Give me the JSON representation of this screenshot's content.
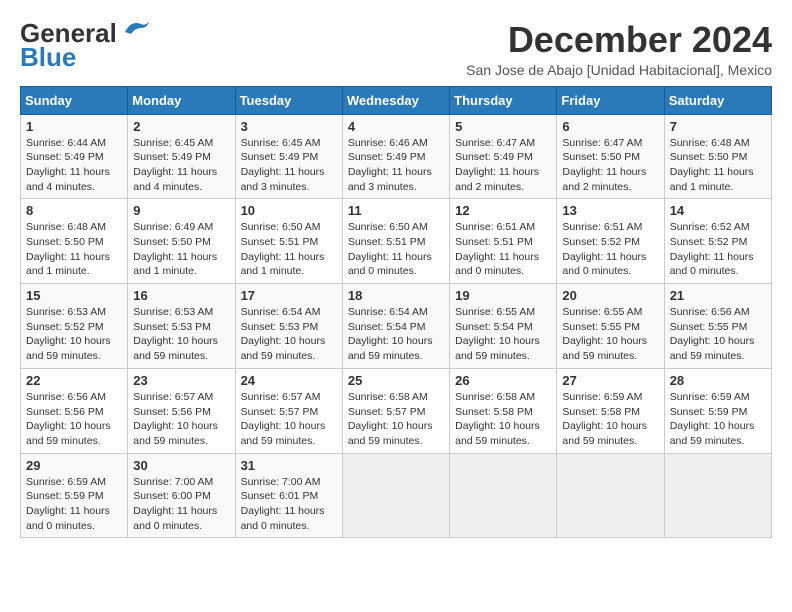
{
  "header": {
    "logo_text1": "General",
    "logo_text2": "Blue",
    "month_title": "December 2024",
    "location": "San Jose de Abajo [Unidad Habitacional], Mexico"
  },
  "weekdays": [
    "Sunday",
    "Monday",
    "Tuesday",
    "Wednesday",
    "Thursday",
    "Friday",
    "Saturday"
  ],
  "weeks": [
    [
      {
        "day": "1",
        "sunrise": "6:44 AM",
        "sunset": "5:49 PM",
        "daylight": "11 hours and 4 minutes."
      },
      {
        "day": "2",
        "sunrise": "6:45 AM",
        "sunset": "5:49 PM",
        "daylight": "11 hours and 4 minutes."
      },
      {
        "day": "3",
        "sunrise": "6:45 AM",
        "sunset": "5:49 PM",
        "daylight": "11 hours and 3 minutes."
      },
      {
        "day": "4",
        "sunrise": "6:46 AM",
        "sunset": "5:49 PM",
        "daylight": "11 hours and 3 minutes."
      },
      {
        "day": "5",
        "sunrise": "6:47 AM",
        "sunset": "5:49 PM",
        "daylight": "11 hours and 2 minutes."
      },
      {
        "day": "6",
        "sunrise": "6:47 AM",
        "sunset": "5:50 PM",
        "daylight": "11 hours and 2 minutes."
      },
      {
        "day": "7",
        "sunrise": "6:48 AM",
        "sunset": "5:50 PM",
        "daylight": "11 hours and 1 minute."
      }
    ],
    [
      {
        "day": "8",
        "sunrise": "6:48 AM",
        "sunset": "5:50 PM",
        "daylight": "11 hours and 1 minute."
      },
      {
        "day": "9",
        "sunrise": "6:49 AM",
        "sunset": "5:50 PM",
        "daylight": "11 hours and 1 minute."
      },
      {
        "day": "10",
        "sunrise": "6:50 AM",
        "sunset": "5:51 PM",
        "daylight": "11 hours and 1 minute."
      },
      {
        "day": "11",
        "sunrise": "6:50 AM",
        "sunset": "5:51 PM",
        "daylight": "11 hours and 0 minutes."
      },
      {
        "day": "12",
        "sunrise": "6:51 AM",
        "sunset": "5:51 PM",
        "daylight": "11 hours and 0 minutes."
      },
      {
        "day": "13",
        "sunrise": "6:51 AM",
        "sunset": "5:52 PM",
        "daylight": "11 hours and 0 minutes."
      },
      {
        "day": "14",
        "sunrise": "6:52 AM",
        "sunset": "5:52 PM",
        "daylight": "11 hours and 0 minutes."
      }
    ],
    [
      {
        "day": "15",
        "sunrise": "6:53 AM",
        "sunset": "5:52 PM",
        "daylight": "10 hours and 59 minutes."
      },
      {
        "day": "16",
        "sunrise": "6:53 AM",
        "sunset": "5:53 PM",
        "daylight": "10 hours and 59 minutes."
      },
      {
        "day": "17",
        "sunrise": "6:54 AM",
        "sunset": "5:53 PM",
        "daylight": "10 hours and 59 minutes."
      },
      {
        "day": "18",
        "sunrise": "6:54 AM",
        "sunset": "5:54 PM",
        "daylight": "10 hours and 59 minutes."
      },
      {
        "day": "19",
        "sunrise": "6:55 AM",
        "sunset": "5:54 PM",
        "daylight": "10 hours and 59 minutes."
      },
      {
        "day": "20",
        "sunrise": "6:55 AM",
        "sunset": "5:55 PM",
        "daylight": "10 hours and 59 minutes."
      },
      {
        "day": "21",
        "sunrise": "6:56 AM",
        "sunset": "5:55 PM",
        "daylight": "10 hours and 59 minutes."
      }
    ],
    [
      {
        "day": "22",
        "sunrise": "6:56 AM",
        "sunset": "5:56 PM",
        "daylight": "10 hours and 59 minutes."
      },
      {
        "day": "23",
        "sunrise": "6:57 AM",
        "sunset": "5:56 PM",
        "daylight": "10 hours and 59 minutes."
      },
      {
        "day": "24",
        "sunrise": "6:57 AM",
        "sunset": "5:57 PM",
        "daylight": "10 hours and 59 minutes."
      },
      {
        "day": "25",
        "sunrise": "6:58 AM",
        "sunset": "5:57 PM",
        "daylight": "10 hours and 59 minutes."
      },
      {
        "day": "26",
        "sunrise": "6:58 AM",
        "sunset": "5:58 PM",
        "daylight": "10 hours and 59 minutes."
      },
      {
        "day": "27",
        "sunrise": "6:59 AM",
        "sunset": "5:58 PM",
        "daylight": "10 hours and 59 minutes."
      },
      {
        "day": "28",
        "sunrise": "6:59 AM",
        "sunset": "5:59 PM",
        "daylight": "10 hours and 59 minutes."
      }
    ],
    [
      {
        "day": "29",
        "sunrise": "6:59 AM",
        "sunset": "5:59 PM",
        "daylight": "11 hours and 0 minutes."
      },
      {
        "day": "30",
        "sunrise": "7:00 AM",
        "sunset": "6:00 PM",
        "daylight": "11 hours and 0 minutes."
      },
      {
        "day": "31",
        "sunrise": "7:00 AM",
        "sunset": "6:01 PM",
        "daylight": "11 hours and 0 minutes."
      },
      null,
      null,
      null,
      null
    ]
  ],
  "labels": {
    "sunrise": "Sunrise:",
    "sunset": "Sunset:",
    "daylight": "Daylight:"
  }
}
